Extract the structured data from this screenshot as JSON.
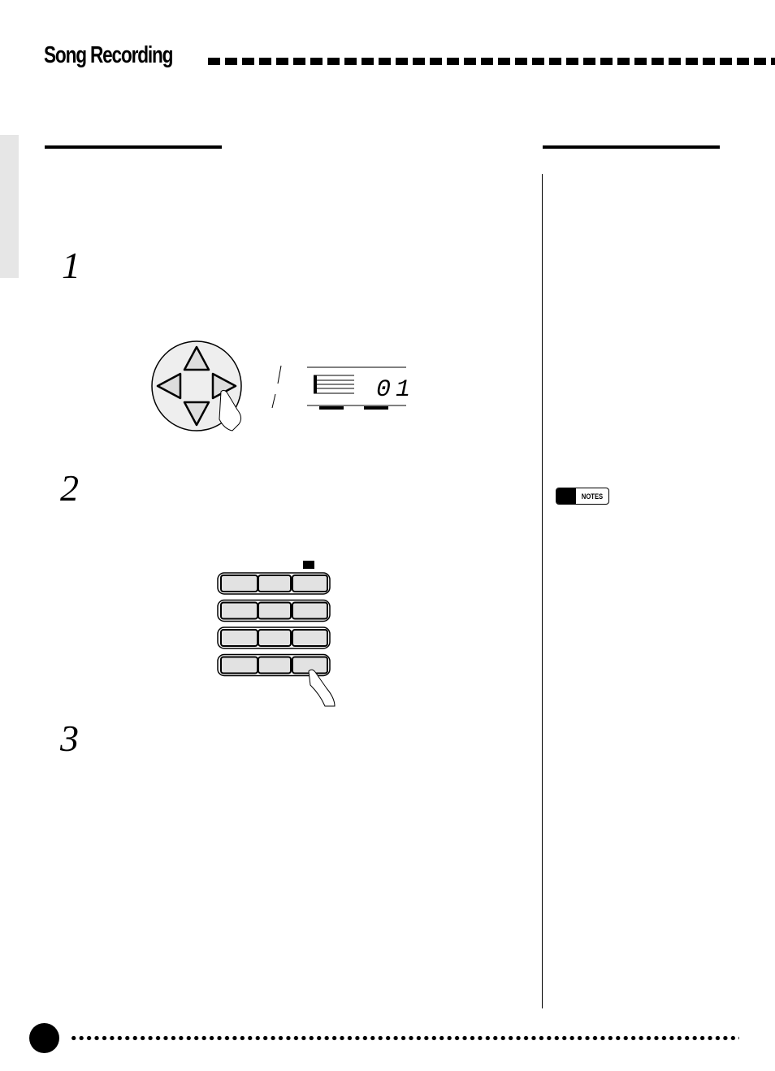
{
  "header": {
    "title": "Song Recording"
  },
  "steps": [
    "1",
    "2",
    "3"
  ],
  "display": {
    "value": "01"
  },
  "notes": {
    "label": "NOTES",
    "icon": "notes-speech-icon"
  },
  "icons": {
    "cursor": "cursor-pad-icon",
    "hand": "pressing-hand-icon",
    "card": "card-icon"
  }
}
